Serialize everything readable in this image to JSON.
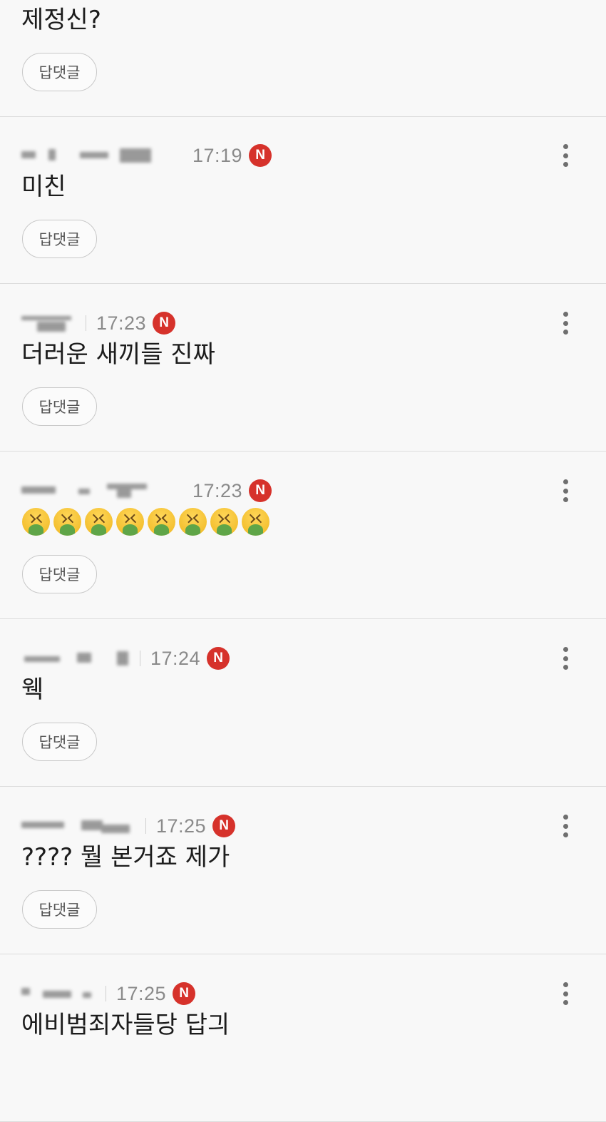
{
  "reply_label": "답댓글",
  "comments": [
    {
      "text": "제정신?"
    },
    {
      "time": "17:19",
      "badge": "N",
      "text": "미친"
    },
    {
      "time": "17:23",
      "badge": "N",
      "text": "더러운 새끼들 진짜"
    },
    {
      "time": "17:23",
      "badge": "N",
      "emoji": "nauseated-face",
      "emoji_count": 8
    },
    {
      "time": "17:24",
      "badge": "N",
      "text": "웩"
    },
    {
      "time": "17:25",
      "badge": "N",
      "text": "???? 뭘 본거죠 제가"
    },
    {
      "time": "17:25",
      "badge": "N",
      "text": "에비범죄자들당 답긔"
    }
  ]
}
